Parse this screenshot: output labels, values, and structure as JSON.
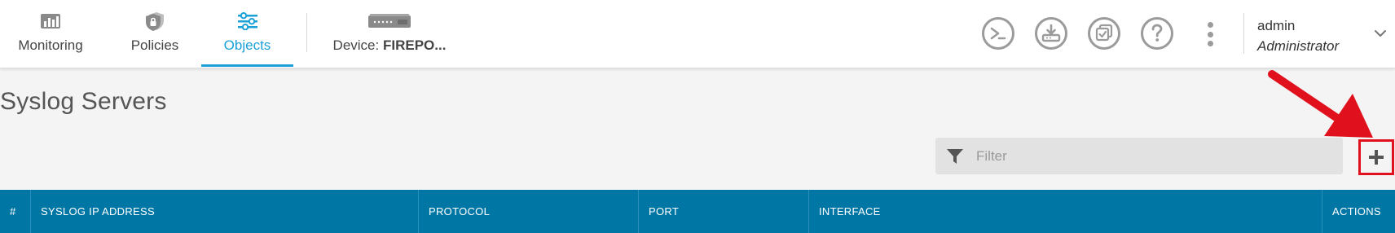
{
  "nav": {
    "monitoring": "Monitoring",
    "policies": "Policies",
    "objects": "Objects",
    "device_prefix": "Device: ",
    "device_name": "FIREPO...",
    "active_tab": "Objects"
  },
  "icons": {
    "monitoring": "monitoring-chart-icon",
    "policies": "policies-shield-icon",
    "objects": "objects-sliders-icon",
    "device": "device-appliance-icon",
    "cli": "cli-console-icon",
    "deploy": "deploy-download-icon",
    "tasks": "task-list-icon",
    "help": "help-question-icon",
    "more": "more-kebab-icon",
    "user_menu": "chevron-down-icon",
    "filter": "filter-funnel-icon",
    "add": "plus-icon"
  },
  "user": {
    "name": "admin",
    "role": "Administrator"
  },
  "page": {
    "title": "Syslog Servers"
  },
  "filter": {
    "placeholder": "Filter",
    "value": ""
  },
  "table": {
    "columns": [
      "#",
      "SYSLOG IP ADDRESS",
      "PROTOCOL",
      "PORT",
      "INTERFACE",
      "ACTIONS"
    ]
  },
  "colors": {
    "accent": "#1ba0d7",
    "table_header": "#0076a5",
    "highlight": "#e0111c",
    "icon_gray": "#9b9b9b"
  }
}
